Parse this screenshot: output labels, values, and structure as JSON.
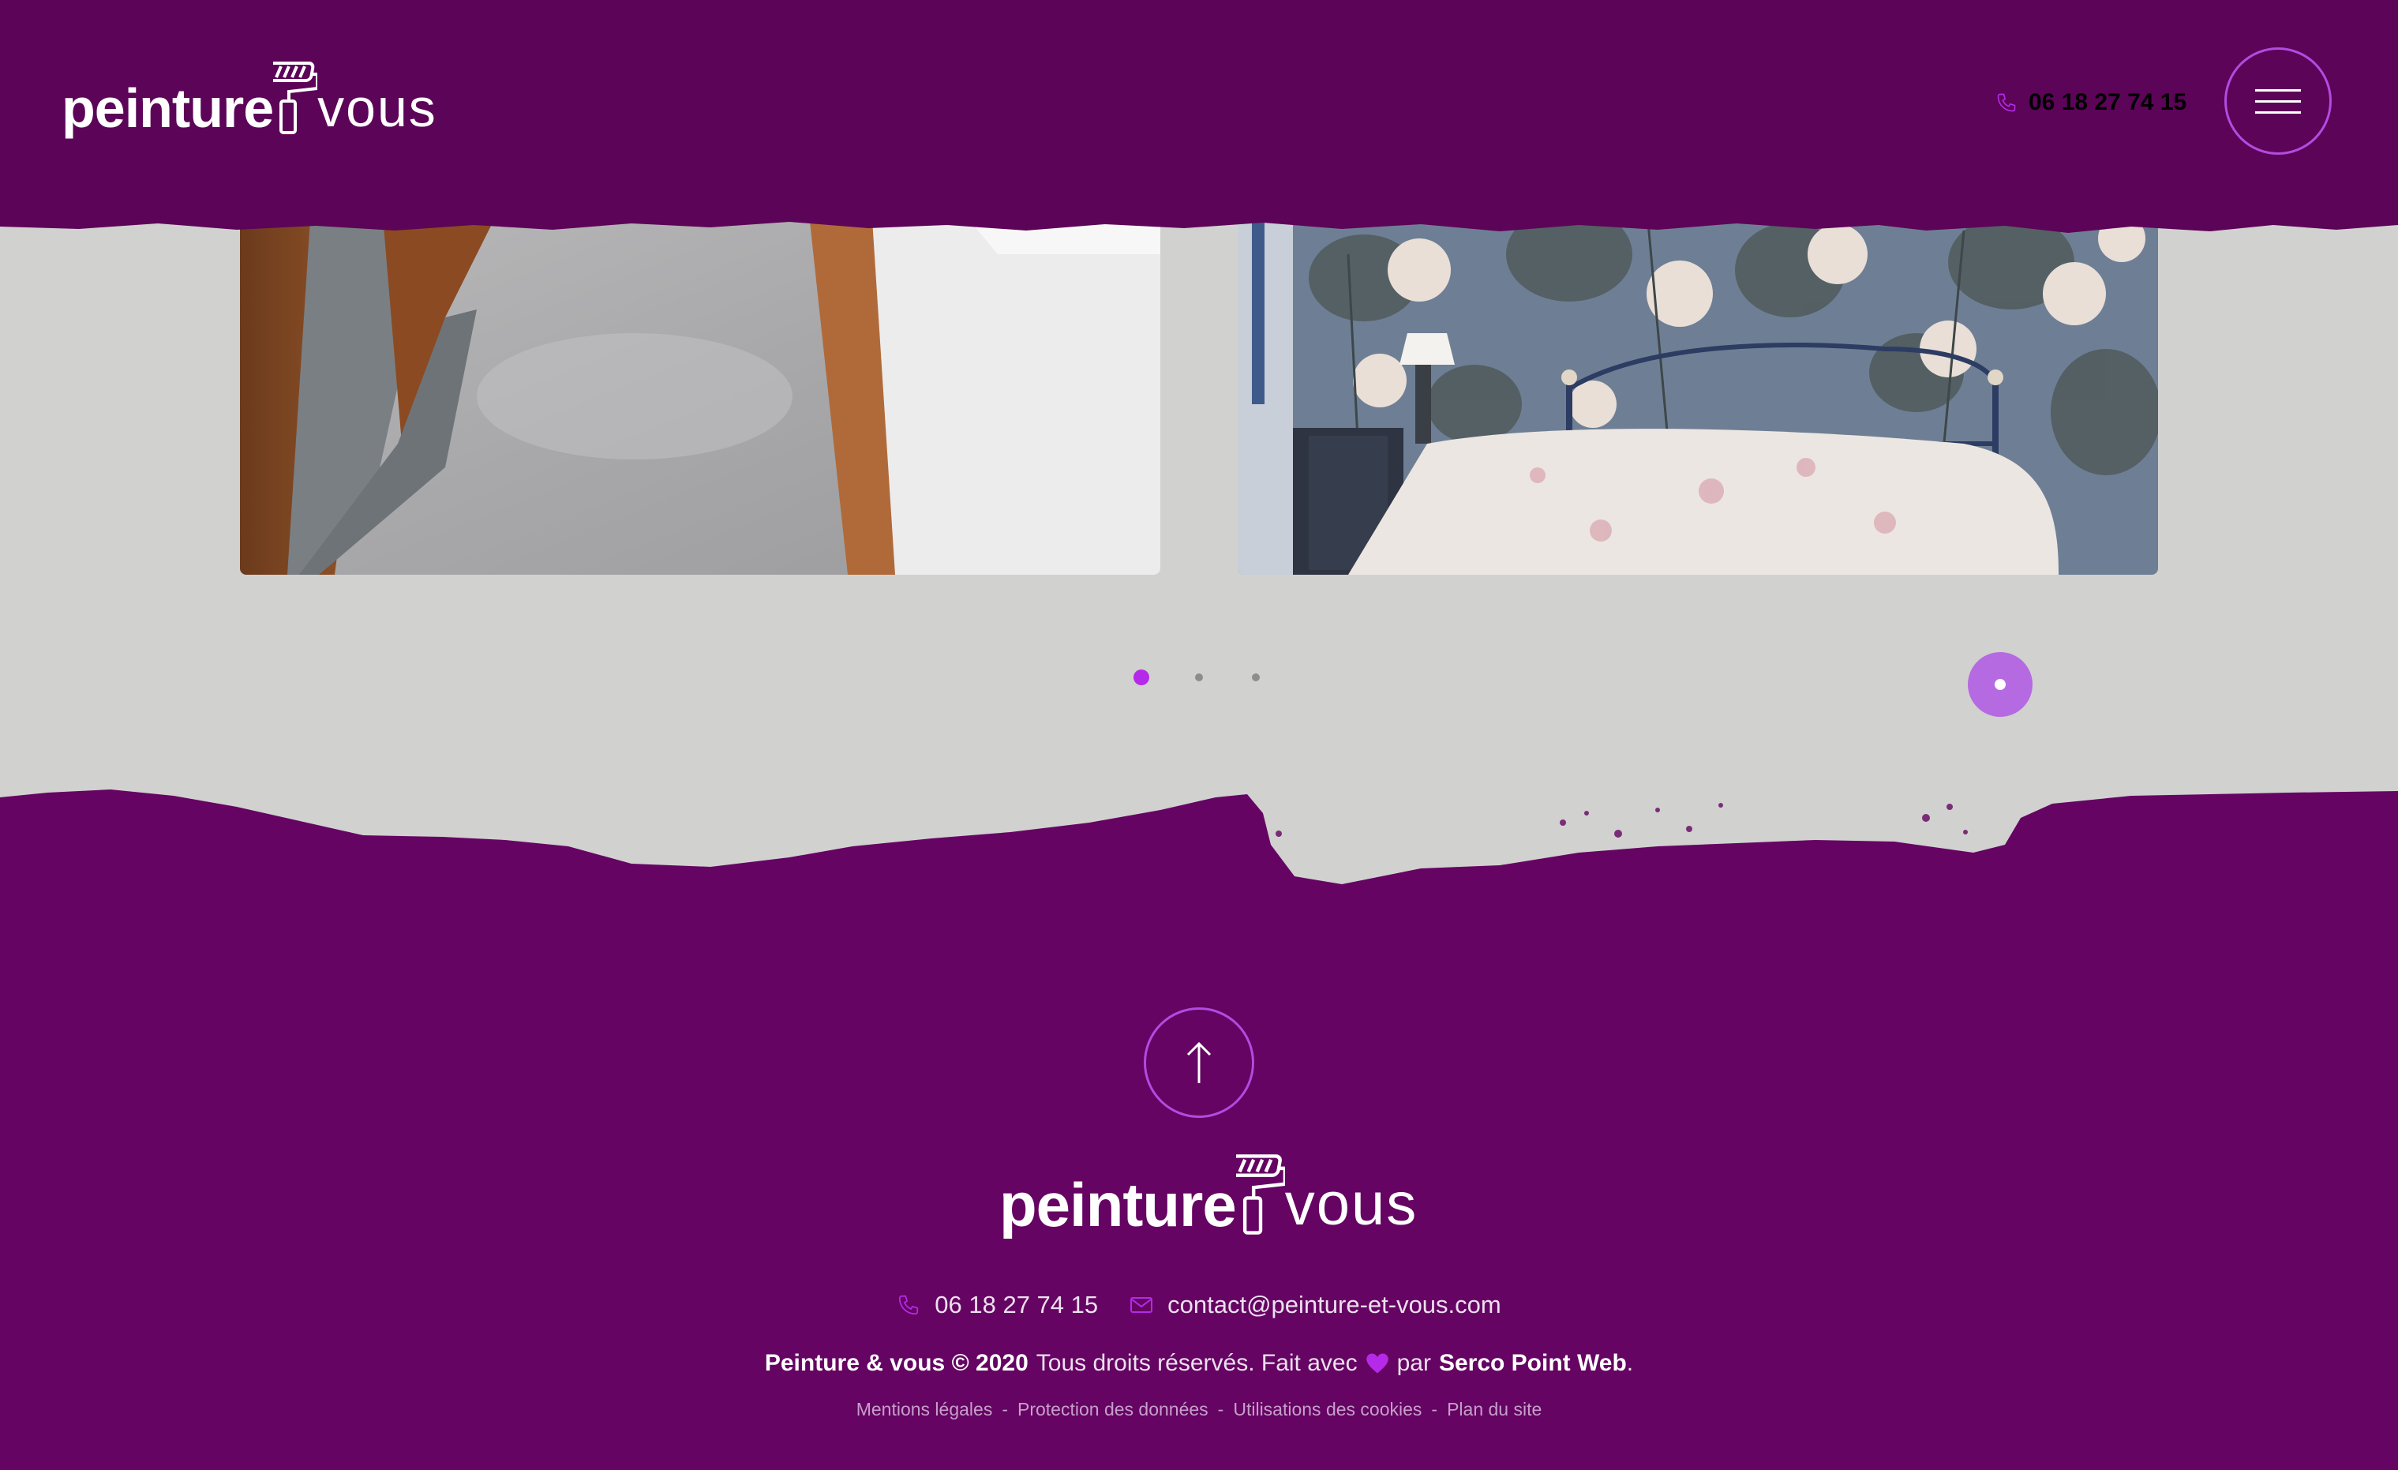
{
  "header": {
    "logo": {
      "word1": "peinture",
      "word2": "vous"
    },
    "phone": "06 18 27 74 15",
    "icons": {
      "phone": "phone-icon",
      "menu": "hamburger-menu-icon"
    }
  },
  "gallery": {
    "images": [
      {
        "name": "hallway-floor-photo"
      },
      {
        "name": "bedroom-floral-wallpaper-photo"
      }
    ],
    "pagination": {
      "total": 3,
      "active": 1
    }
  },
  "footer": {
    "logo": {
      "word1": "peinture",
      "word2": "vous"
    },
    "phone": "06 18 27 74 15",
    "email": "contact@peinture-et-vous.com",
    "copyright": {
      "brand": "Peinture & vous © 2020",
      "text_before": "Tous droits réservés. Fait avec",
      "text_par": "par",
      "agency": "Serco Point Web",
      "period": "."
    },
    "legal_links": [
      "Mentions légales",
      "Protection des données",
      "Utilisations des cookies",
      "Plan du site"
    ],
    "legal_separator": "-",
    "icons": {
      "phone": "phone-icon",
      "email": "envelope-icon",
      "heart": "heart-icon",
      "to_top": "arrow-up-icon"
    }
  },
  "colors": {
    "header_bg": "#5c0458",
    "footer_bg": "#650462",
    "page_bg": "#d1d1d0",
    "accent": "#b52ae8",
    "float_button": "#b66ae2"
  }
}
